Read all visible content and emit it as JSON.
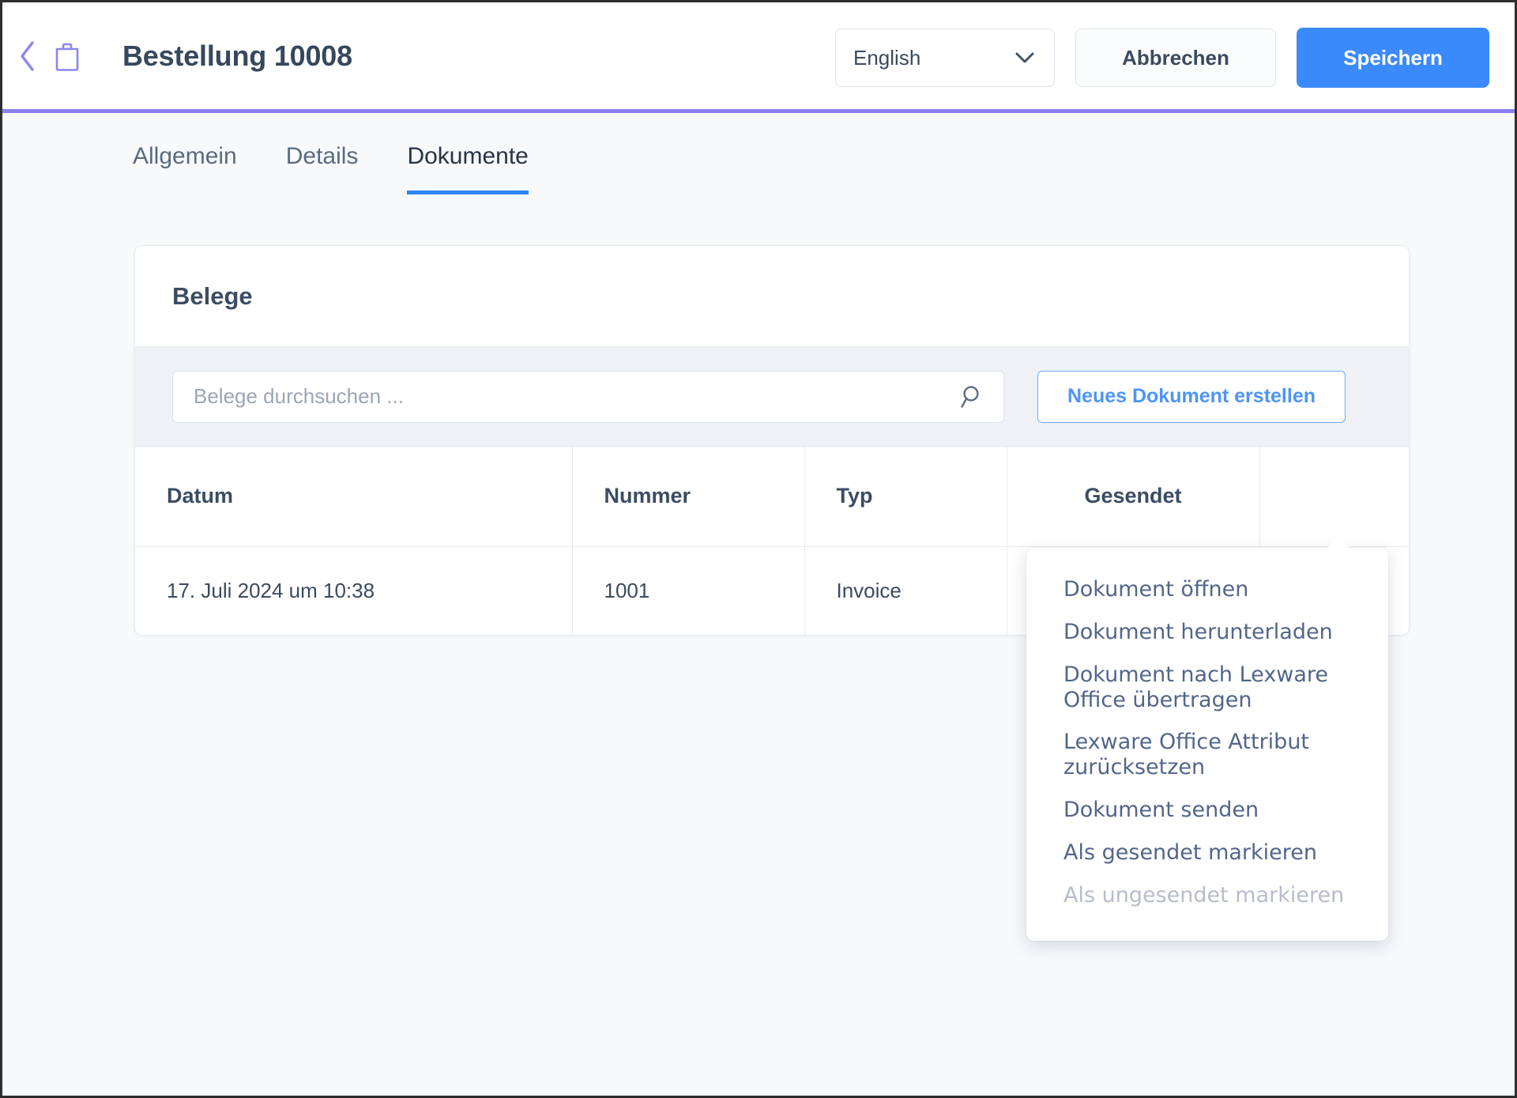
{
  "header": {
    "back_icon": "chevron-left-icon",
    "bag_icon": "shopping-bag-icon",
    "title": "Bestellung 10008",
    "language": {
      "value": "English",
      "caret_icon": "chevron-down-icon"
    },
    "cancel_label": "Abbrechen",
    "save_label": "Speichern",
    "accent_purple": "#8b80f0",
    "accent_blue": "#3b8afc"
  },
  "tabs": [
    {
      "label": "Allgemein",
      "active": false
    },
    {
      "label": "Details",
      "active": false
    },
    {
      "label": "Dokumente",
      "active": true
    }
  ],
  "card": {
    "title": "Belege",
    "toolbar": {
      "search_placeholder": "Belege durchsuchen ...",
      "search_value": "",
      "search_icon": "search-icon",
      "new_document_label": "Neues Dokument erstellen"
    },
    "table": {
      "columns": [
        "Datum",
        "Nummer",
        "Typ",
        "Gesendet",
        ""
      ],
      "rows": [
        {
          "datum": "17. Juli 2024 um 10:38",
          "nummer": "1001",
          "typ": "Invoice",
          "gesendet": "✕",
          "gesendet_color": "#c62b2b",
          "actions_icon": "kebab-menu-icon"
        }
      ]
    }
  },
  "context_menu": {
    "items": [
      {
        "label": "Dokument öffnen",
        "disabled": false
      },
      {
        "label": "Dokument herunterladen",
        "disabled": false
      },
      {
        "label": "Dokument nach Lexware Office übertragen",
        "disabled": false
      },
      {
        "label": "Lexware Office Attribut zurücksetzen",
        "disabled": false
      },
      {
        "label": "Dokument senden",
        "disabled": false
      },
      {
        "label": "Als gesendet markieren",
        "disabled": false
      },
      {
        "label": "Als ungesendet markieren",
        "disabled": true
      }
    ]
  }
}
